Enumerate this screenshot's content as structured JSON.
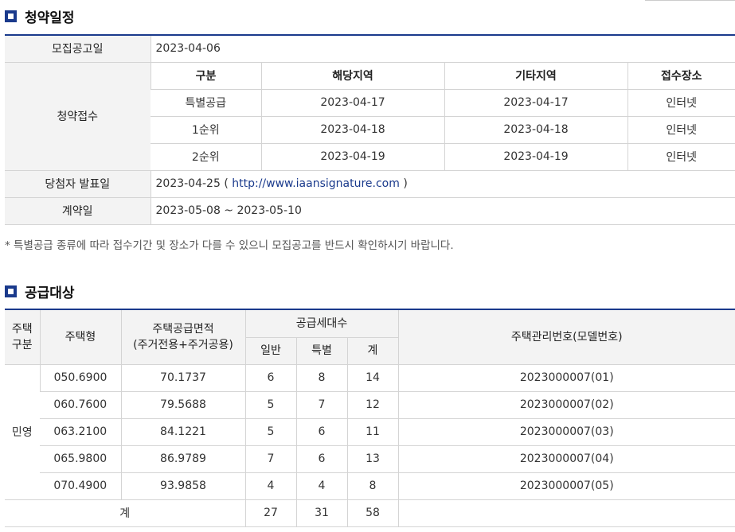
{
  "schedule_section": {
    "title": "청약일정",
    "announcement": {
      "label": "모집공고일",
      "value": "2023-04-06"
    },
    "application": {
      "label": "청약접수",
      "headers": [
        "구분",
        "해당지역",
        "기타지역",
        "접수장소"
      ],
      "rows": [
        {
          "type": "특별공급",
          "local": "2023-04-17",
          "other": "2023-04-17",
          "place": "인터넷"
        },
        {
          "type": "1순위",
          "local": "2023-04-18",
          "other": "2023-04-18",
          "place": "인터넷"
        },
        {
          "type": "2순위",
          "local": "2023-04-19",
          "other": "2023-04-19",
          "place": "인터넷"
        }
      ]
    },
    "winner": {
      "label": "당첨자 발표일",
      "date": "2023-04-25",
      "open_paren": "(",
      "url": "http://www.iaansignature.com",
      "close_paren": ")"
    },
    "contract": {
      "label": "계약일",
      "value": "2023-05-08 ~ 2023-05-10"
    },
    "note": "* 특별공급 종류에 따라 접수기간 및 장소가 다를 수 있으니 모집공고를 반드시 확인하시기 바랍니다."
  },
  "supply_section": {
    "title": "공급대상",
    "headers": {
      "category_line1": "주택",
      "category_line2": "구분",
      "house_type": "주택형",
      "area_line1": "주택공급면적",
      "area_line2": "(주거전용+주거공용)",
      "households": "공급세대수",
      "general": "일반",
      "special": "특별",
      "total": "계",
      "mgmt": "주택관리번호(모델번호)"
    },
    "category": "민영",
    "rows": [
      {
        "type": "050.6900",
        "area": "70.1737",
        "general": "6",
        "special": "8",
        "total": "14",
        "mgmt": "2023000007(01)"
      },
      {
        "type": "060.7600",
        "area": "79.5688",
        "general": "5",
        "special": "7",
        "total": "12",
        "mgmt": "2023000007(02)"
      },
      {
        "type": "063.2100",
        "area": "84.1221",
        "general": "5",
        "special": "6",
        "total": "11",
        "mgmt": "2023000007(03)"
      },
      {
        "type": "065.9800",
        "area": "86.9789",
        "general": "7",
        "special": "6",
        "total": "13",
        "mgmt": "2023000007(04)"
      },
      {
        "type": "070.4900",
        "area": "93.9858",
        "general": "4",
        "special": "4",
        "total": "8",
        "mgmt": "2023000007(05)"
      }
    ],
    "sum": {
      "label": "계",
      "general": "27",
      "special": "31",
      "total": "58"
    }
  },
  "colors": {
    "accent": "#1a3a8c",
    "header_bg": "#f3f3f3",
    "border": "#d4d4d4"
  }
}
